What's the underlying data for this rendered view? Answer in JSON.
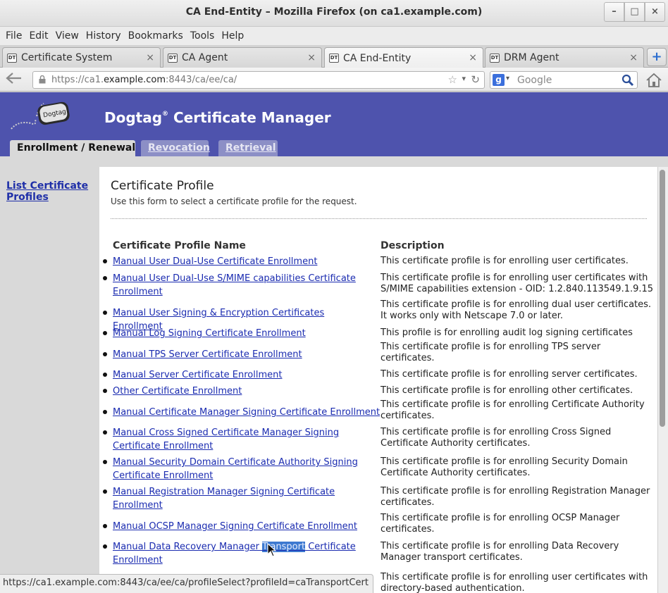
{
  "window": {
    "title": "CA End-Entity – Mozilla Firefox (on ca1.example.com)"
  },
  "window_buttons": [
    "–",
    "□",
    "×"
  ],
  "menus": [
    "File",
    "Edit",
    "View",
    "History",
    "Bookmarks",
    "Tools",
    "Help"
  ],
  "tabs": [
    {
      "label": "Certificate System",
      "active": false
    },
    {
      "label": "CA Agent",
      "active": false
    },
    {
      "label": "CA End-Entity",
      "active": true
    },
    {
      "label": "DRM Agent",
      "active": false
    }
  ],
  "tab_close_glyph": "×",
  "new_tab_glyph": "+",
  "favicon_text": "DT",
  "nav": {
    "url_prefix": "https://ca1.",
    "url_domain": "example.com",
    "url_rest": ":8443/ca/ee/ca/",
    "search_placeholder": "Google",
    "search_engine_letter": "g"
  },
  "banner": {
    "logo_text": "Dogtag",
    "product_name": "Dogtag",
    "registered_mark": "®",
    "product_rest": " Certificate Manager",
    "bg_color": "#4e53ad"
  },
  "page_tabs": [
    {
      "label": "Enrollment / Renewal",
      "active": true
    },
    {
      "label": "Revocation",
      "active": false
    },
    {
      "label": "Retrieval",
      "active": false
    }
  ],
  "left_nav": {
    "link": "List Certificate Profiles"
  },
  "content": {
    "title": "Certificate Profile",
    "subtitle": "Use this form to select a certificate profile for the request.",
    "col_name": "Certificate Profile Name",
    "col_desc": "Description"
  },
  "profiles": [
    {
      "name": "Manual User Dual-Use Certificate Enrollment",
      "desc": "This certificate profile is for enrolling user certificates."
    },
    {
      "name": "Manual User Dual-Use S/MIME capabilities Certificate Enrollment",
      "desc": "This certificate profile is for enrolling user certificates with S/MIME capabilities extension - OID: 1.2.840.113549.1.9.15"
    },
    {
      "name": "Manual User Signing & Encryption Certificates Enrollment",
      "desc": "This certificate profile is for enrolling dual user certificates. It works only with Netscape 7.0 or later."
    },
    {
      "name": "Manual Log Signing Certificate Enrollment",
      "desc": "This profile is for enrolling audit log signing certificates"
    },
    {
      "name": "Manual TPS Server Certificate Enrollment",
      "desc": "This certificate profile is for enrolling TPS server certificates."
    },
    {
      "name": "Manual Server Certificate Enrollment",
      "desc": "This certificate profile is for enrolling server certificates."
    },
    {
      "name": "Other Certificate Enrollment",
      "desc": "This certificate profile is for enrolling other certificates."
    },
    {
      "name": "Manual Certificate Manager Signing Certificate Enrollment",
      "desc": "This certificate profile is for enrolling Certificate Authority certificates."
    },
    {
      "name": "Manual Cross Signed Certificate Manager Signing Certificate Enrollment",
      "desc": "This certificate profile is for enrolling Cross Signed Certificate Authority certificates."
    },
    {
      "name": "Manual Security Domain Certificate Authority Signing Certificate Enrollment",
      "desc": "This certificate profile is for enrolling Security Domain Certificate Authority certificates."
    },
    {
      "name": "Manual Registration Manager Signing Certificate Enrollment",
      "desc": "This certificate profile is for enrolling Registration Manager certificates."
    },
    {
      "name": "Manual OCSP Manager Signing Certificate Enrollment",
      "desc": "This certificate profile is for enrolling OCSP Manager certificates."
    },
    {
      "name_before": "Manual Data Recovery Manager ",
      "name_selected": "Transport",
      "name_after": " Certificate Enrollment",
      "desc": "This certificate profile is for enrolling Data Recovery Manager transport certificates."
    },
    {
      "name": "",
      "desc": "This certificate profile is for enrolling user certificates with directory-based authentication."
    }
  ],
  "status_url": "https://ca1.example.com:8443/ca/ee/ca/profileSelect?profileId=caTransportCert"
}
